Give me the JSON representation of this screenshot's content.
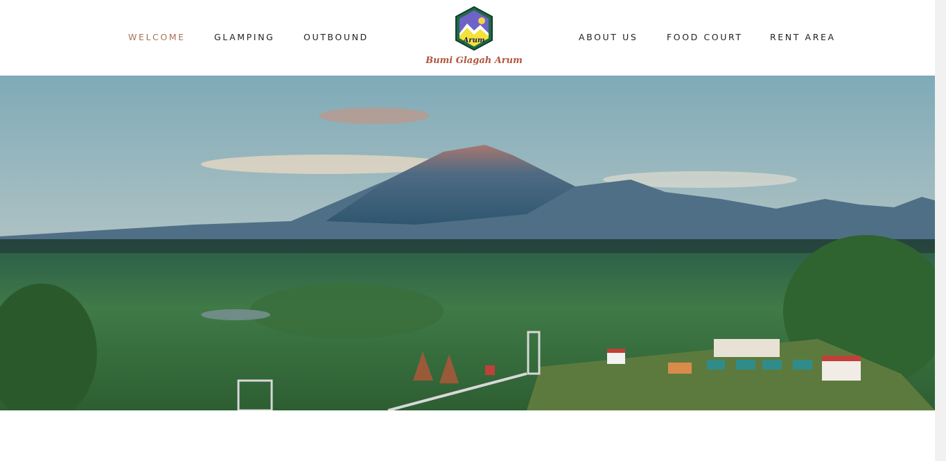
{
  "nav": {
    "left": [
      {
        "label": "WELCOME",
        "active": true
      },
      {
        "label": "GLAMPING",
        "active": false
      },
      {
        "label": "OUTBOUND",
        "active": false
      }
    ],
    "right": [
      {
        "label": "ABOUT US",
        "active": false
      },
      {
        "label": "FOOD COURT",
        "active": false
      },
      {
        "label": "RENT AREA",
        "active": false
      }
    ]
  },
  "logo": {
    "name": "Bumi Glagah Arum",
    "badge_text": "Arum"
  },
  "colors": {
    "accent": "#a87259",
    "logo_text": "#b0553c",
    "sky_top": "#7faab8",
    "forest": "#2f6b3f"
  }
}
